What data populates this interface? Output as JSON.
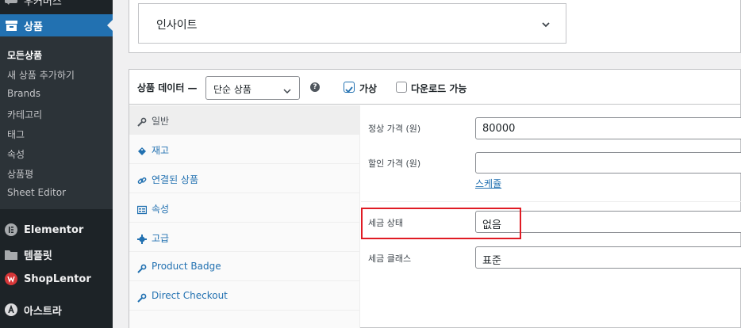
{
  "sidebar": {
    "woo_label": "우커머스",
    "products_label": "상품",
    "sub_items": [
      "모든상품",
      "새 상품 추가하기",
      "Brands",
      "카테고리",
      "태그",
      "속성",
      "상품평",
      "Sheet Editor"
    ],
    "elementor_label": "Elementor",
    "templates_label": "템플릿",
    "shoplentor_label": "ShopLentor",
    "astra_label": "아스트라"
  },
  "insight": {
    "label": "인사이트"
  },
  "product_data": {
    "title": "상품 데이터 —",
    "type_select": "단순 상품",
    "help": "?",
    "virtual_label": "가상",
    "virtual_checked": true,
    "downloadable_label": "다운로드 가능",
    "downloadable_checked": false,
    "tabs": [
      "일반",
      "재고",
      "연결된 상품",
      "속성",
      "고급",
      "Product Badge",
      "Direct Checkout"
    ],
    "fields": {
      "regular_price_label": "정상 가격 (원)",
      "regular_price_value": "80000",
      "sale_price_label": "할인 가격 (원)",
      "sale_price_value": "",
      "schedule_link": "스케쥴",
      "tax_status_label": "세금 상태",
      "tax_status_value": "없음",
      "tax_class_label": "세금 클래스",
      "tax_class_value": "표준"
    }
  },
  "colors": {
    "accent": "#2271b1",
    "sidebar_bg": "#1d2327",
    "submenu_bg": "#2c3338",
    "highlight": "#e01b24"
  }
}
